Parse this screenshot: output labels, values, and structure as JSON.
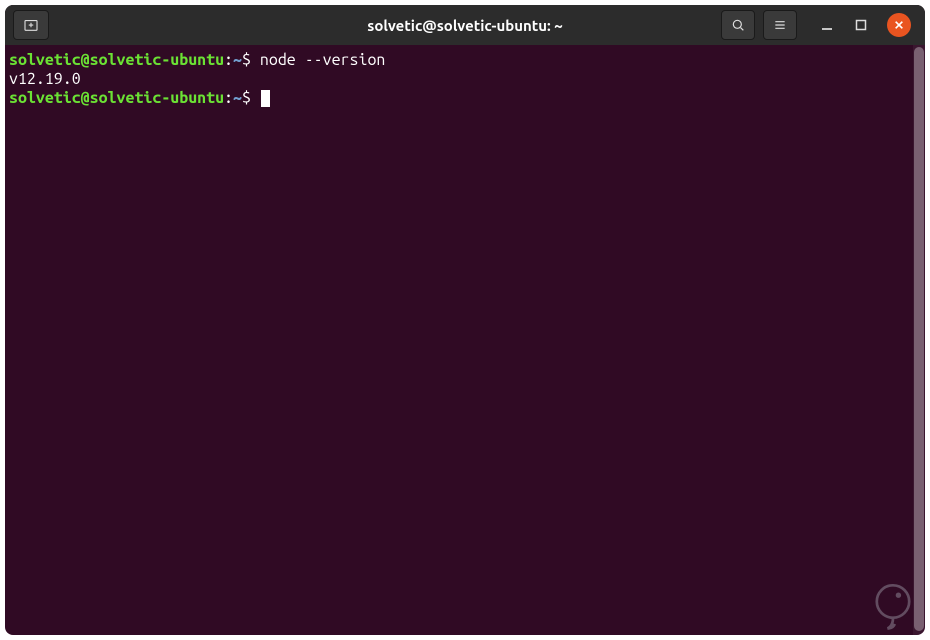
{
  "window": {
    "title": "solvetic@solvetic-ubuntu: ~"
  },
  "prompt": {
    "user_host": "solvetic@solvetic-ubuntu",
    "path": "~",
    "symbol": "$"
  },
  "lines": [
    {
      "command": "node --version"
    },
    {
      "output": "v12.19.0"
    }
  ],
  "colors": {
    "titlebar": "#2c2c2c",
    "terminal_bg": "#300a24",
    "prompt_user": "#6be234",
    "prompt_path": "#729fcf",
    "text": "#ffffff",
    "close_button": "#e95420"
  }
}
